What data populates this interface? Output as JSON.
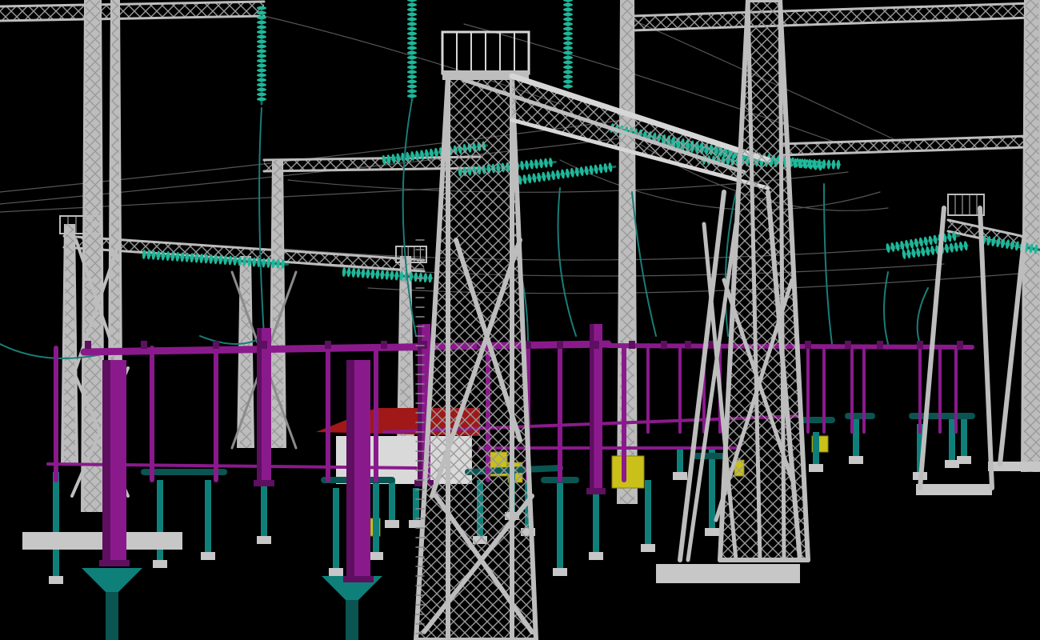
{
  "scene": {
    "background": "#000000",
    "colors": {
      "steel": "#bdbdbd",
      "steel_dark": "#8c8c8c",
      "steel_light": "#d6d6d6",
      "busbar": "#8a1a8c",
      "busbar_dark": "#5e0f60",
      "insulator_green": "#1fb89a",
      "insulator_dark": "#0f6b5a",
      "support_teal": "#0f7f7a",
      "support_teal_dark": "#0a5552",
      "cable": "#1a7d78",
      "wire": "#555555",
      "cabinet_yellow": "#c9c01a",
      "roof_red": "#a01818",
      "building_white": "#d9d9d9",
      "foundation": "#c7c7c7"
    }
  }
}
